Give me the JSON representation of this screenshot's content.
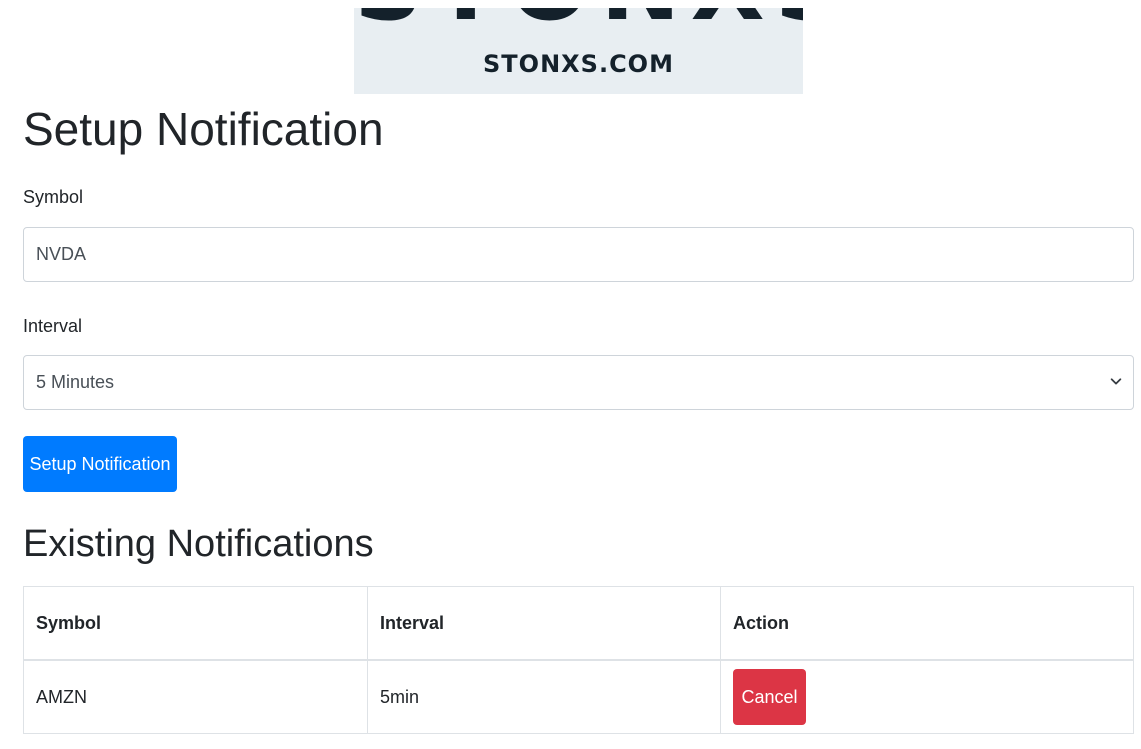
{
  "logo": {
    "big_text": "STONXS",
    "small_text": "STONXS.COM"
  },
  "form": {
    "title": "Setup Notification",
    "symbol_label": "Symbol",
    "symbol_value": "NVDA",
    "interval_label": "Interval",
    "interval_selected": "5 Minutes",
    "submit_label": "Setup Notification"
  },
  "existing": {
    "title": "Existing Notifications",
    "columns": [
      "Symbol",
      "Interval",
      "Action"
    ],
    "rows": [
      {
        "symbol": "AMZN",
        "interval": "5min",
        "action_label": "Cancel"
      }
    ]
  },
  "colors": {
    "primary": "#007bff",
    "danger": "#dc3545"
  },
  "icons": {
    "select_chevron": "chevron-down-icon"
  }
}
